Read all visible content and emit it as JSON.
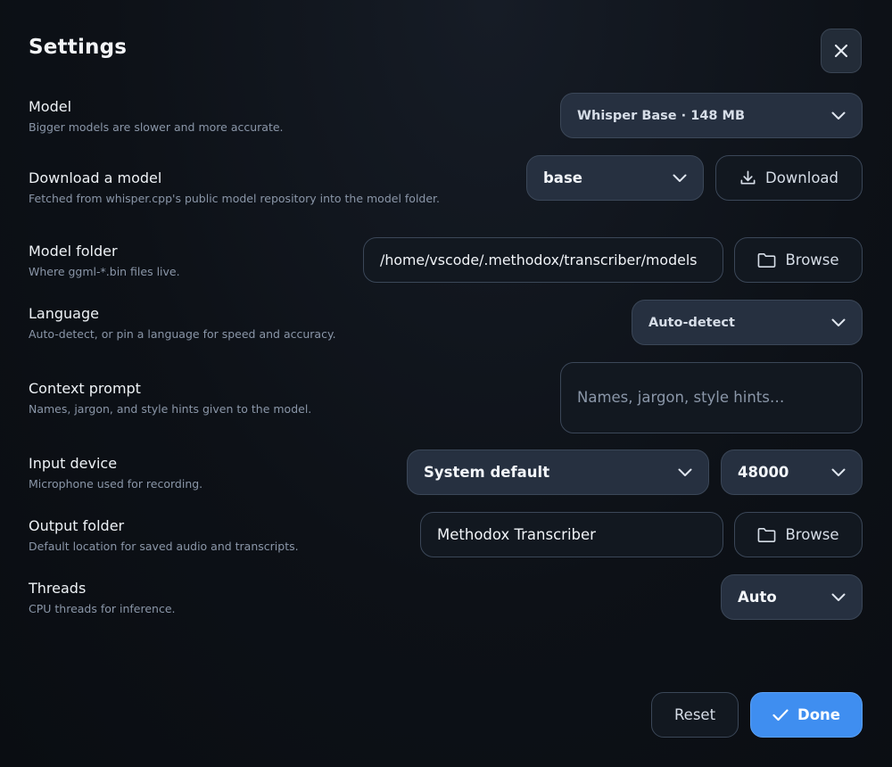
{
  "header": {
    "title": "Settings",
    "close_icon": "close-icon"
  },
  "rows": {
    "model": {
      "label": "Model",
      "description": "Bigger models are slower and more accurate.",
      "value": "Whisper Base · 148 MB"
    },
    "download": {
      "label": "Download a model",
      "description": "Fetched from whisper.cpp's public model repository into the model folder.",
      "value": "base",
      "button_label": "Download",
      "button_icon": "download-icon"
    },
    "model_folder": {
      "label": "Model folder",
      "description": "Where ggml-*.bin files live.",
      "value": "/home/vscode/.methodox/transcriber/models",
      "button_label": "Browse",
      "button_icon": "folder-icon"
    },
    "language": {
      "label": "Language",
      "description": "Auto-detect, or pin a language for speed and accuracy.",
      "value": "Auto-detect"
    },
    "context_prompt": {
      "label": "Context prompt",
      "description": "Names, jargon, and style hints given to the model.",
      "placeholder": "Names, jargon, style hints…"
    },
    "input_device": {
      "label": "Input device",
      "description": "Microphone used for recording.",
      "value": "System default",
      "sample_rate": "48000"
    },
    "output_folder": {
      "label": "Output folder",
      "description": "Default location for saved audio and transcripts.",
      "value": "Methodox Transcriber",
      "button_label": "Browse",
      "button_icon": "folder-icon"
    },
    "threads": {
      "label": "Threads",
      "description": "CPU threads for inference.",
      "value": "Auto"
    }
  },
  "footer": {
    "reset_label": "Reset",
    "done_label": "Done",
    "done_icon": "check-icon"
  },
  "colors": {
    "background": "#0d1117",
    "control_bg": "#263040",
    "field_bg": "#121820",
    "border": "#3b4758",
    "accent": "#3f8ef0",
    "muted_text": "#8a96a8"
  }
}
